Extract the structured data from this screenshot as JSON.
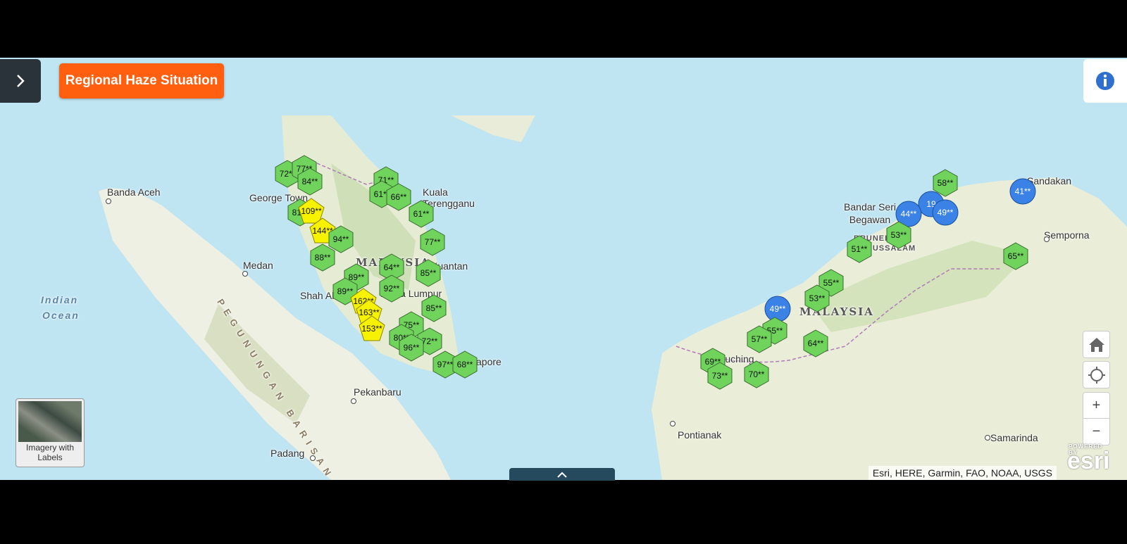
{
  "app": {
    "title": "Regional Haze Situation"
  },
  "places": {
    "banda_aceh": "Banda Aceh",
    "george_town": "George Town",
    "medan": "Medan",
    "kuala_terengganu": "Kuala Terengganu",
    "kuantan": "Kuantan",
    "kuala_lumpur": "Kuala Lumpur",
    "shah_alam": "Shah Alam",
    "singapore": "Singapore",
    "pekanbaru": "Pekanbaru",
    "padang": "Padang",
    "bandar_seri_begawan": "Bandar Seri Begawan",
    "brunei": "BRUNEI DARUSSALAM",
    "sandakan": "Sandakan",
    "semporna": "Semporna",
    "kuching": "Kuching",
    "pontianak": "Pontianak",
    "samarinda": "Samarinda",
    "malaysia_west": "MALAYSIA",
    "malaysia_east": "MALAYSIA",
    "indian_ocean_1": "Indian",
    "indian_ocean_2": "Ocean",
    "pegunungan": "PEGUNUNGAN BARISAN"
  },
  "markers": [
    {
      "label": "72**",
      "status": "good"
    },
    {
      "label": "77**",
      "status": "good"
    },
    {
      "label": "84**",
      "status": "good"
    },
    {
      "label": "71**",
      "status": "good"
    },
    {
      "label": "61**",
      "status": "good"
    },
    {
      "label": "66**",
      "status": "good"
    },
    {
      "label": "61**",
      "status": "good"
    },
    {
      "label": "81**",
      "status": "good"
    },
    {
      "label": "109**",
      "status": "unhealthy"
    },
    {
      "label": "144**",
      "status": "unhealthy"
    },
    {
      "label": "94**",
      "status": "good"
    },
    {
      "label": "88**",
      "status": "good"
    },
    {
      "label": "77**",
      "status": "good"
    },
    {
      "label": "64**",
      "status": "good"
    },
    {
      "label": "85**",
      "status": "good"
    },
    {
      "label": "89**",
      "status": "good"
    },
    {
      "label": "89**",
      "status": "good"
    },
    {
      "label": "92**",
      "status": "good"
    },
    {
      "label": "162**",
      "status": "unhealthy"
    },
    {
      "label": "163**",
      "status": "unhealthy"
    },
    {
      "label": "85**",
      "status": "good"
    },
    {
      "label": "75**",
      "status": "good"
    },
    {
      "label": "80**",
      "status": "good"
    },
    {
      "label": "153**",
      "status": "unhealthy"
    },
    {
      "label": "72**",
      "status": "good"
    },
    {
      "label": "96**",
      "status": "good"
    },
    {
      "label": "97**",
      "status": "good"
    },
    {
      "label": "68**",
      "status": "good"
    },
    {
      "label": "58**",
      "status": "good"
    },
    {
      "label": "41**",
      "status": "blue"
    },
    {
      "label": "19",
      "status": "blue"
    },
    {
      "label": "44**",
      "status": "blue"
    },
    {
      "label": "49**",
      "status": "blue"
    },
    {
      "label": "53**",
      "status": "good"
    },
    {
      "label": "51**",
      "status": "good"
    },
    {
      "label": "65**",
      "status": "good"
    },
    {
      "label": "55**",
      "status": "good"
    },
    {
      "label": "53**",
      "status": "good"
    },
    {
      "label": "49**",
      "status": "blue"
    },
    {
      "label": "55**",
      "status": "good"
    },
    {
      "label": "57**",
      "status": "good"
    },
    {
      "label": "64**",
      "status": "good"
    },
    {
      "label": "69**",
      "status": "good"
    },
    {
      "label": "73**",
      "status": "good"
    },
    {
      "label": "70**",
      "status": "good"
    }
  ],
  "colors": {
    "good": "#6fd35c",
    "unhealthy": "#f7f200",
    "blue": "#3b82e6",
    "title_bg": "#ff5f0e"
  },
  "controls": {
    "zoom_in": "+",
    "zoom_out": "−",
    "basemap_label": "Imagery with Labels"
  },
  "attribution": "Esri, HERE, Garmin, FAO, NOAA, USGS",
  "esri": {
    "powered": "POWERED BY",
    "logo": "esri"
  },
  "icons": {
    "panel_toggle": "chevron-right-icon",
    "info": "info-icon",
    "home": "home-icon",
    "locate": "locate-icon",
    "expand": "chevron-up-icon"
  }
}
